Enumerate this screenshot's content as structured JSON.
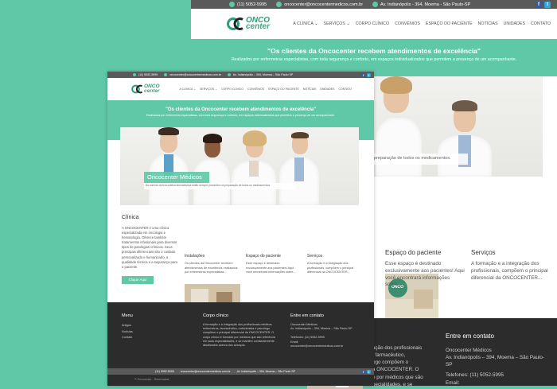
{
  "topbar": {
    "phone": "(11) 5052-5995",
    "email": "oncocenter@oncocentermedicos.com.br",
    "address": "Av. Indianópolis - 394, Moema - São Paulo-SP",
    "address_small": "Av. Indianópolis – 394, Moema – São Paulo SP",
    "social": [
      "f",
      "t"
    ]
  },
  "logo": {
    "line1": "ONCO",
    "line2": "center"
  },
  "nav": [
    "A CLÍNICA ⌄",
    "SERVIÇOS ⌄",
    "CORPO CLÍNICO",
    "CONVÊNIOS",
    "ESPAÇO DO PACIENTE",
    "NOTÍCIAS",
    "UNIDADES",
    "CONTATO"
  ],
  "hero": {
    "title": "\"Os clientes da Oncocenter recebem atendimentos de excelência\"",
    "subtitle": "Realizados por enfermeiras especialistas, com toda segurança e conforto, em espaços individualizados que permitem a presença de um acompanhante.",
    "subtitle_small": "Realizados por enfermeiras especialistas, com toda segurança e conforto, em espaços individualizados que permitem a presença de um acompanhante."
  },
  "slider": {
    "title": "Oncocenter Médicos",
    "caption": "As normas da boa prática farmacêutica estão sempre presentes na preparação de todos os medicamentos.",
    "caption_partial": "preparação de todos os medicamentos."
  },
  "clinica": {
    "title": "Clínica",
    "text": "A ONCOCENTER é uma clínica especializada em oncologia e hematologia. Oferece também tratamentos infusionais para diversos tipos de patologias crônicas. Seus principais diferenciais são o cuidado personalizado e humanizado, a qualidade técnica e a segurança para o paciente.",
    "button": "Clique Aqui"
  },
  "cards_small": [
    {
      "title": "Instalações",
      "text": "Os clientes da Oncocenter recebem atendimentos de excelência, realizados por enfermeiras especialistas..."
    },
    {
      "title": "Espaço do paciente",
      "text": "Esse espaço é destinado exclusivamente aos pacientes! Aqui você encontrará informações sobre..."
    },
    {
      "title": "Serviços",
      "text": "A formação e a integração dos profissionais, compõem o principal diferencial da ONCOCENTER..."
    }
  ],
  "cards_large": [
    {
      "title": "Espaço do paciente",
      "text": "Esse espaço é destinado exclusivamente aos pacientes! Aqui você encontrará informações sobre..."
    },
    {
      "title": "Serviços",
      "text": "A formação e a integração dos profissionais, compõem o principal diferencial da ONCOCENTER..."
    }
  ],
  "footer": {
    "menu_title": "Menu",
    "menu_items": [
      "Artigos",
      "Notícias",
      "Contato"
    ],
    "corpo_title": "Corpo clínico",
    "corpo_text": "A formação e a integração dos profissionais médicos, enfermeiros, farmacêutico, nutricionista e psicólogo compõem o principal diferencial da ONCOCENTER. O corpo clínico é formado por médicos que são referência em suas especialidades, e se mantêm constantemente atualizados acerca dos avanços.",
    "contato_title": "Entre em contato",
    "contato_name": "Oncocenter Médicos",
    "contato_address": "Av. Indianópolis – 394, Moema – São Paulo-SP",
    "contato_phone": "Telefones: (11) 5052-5995",
    "contato_email_label": "Email:",
    "contato_email": "oncocenter@oncocentermedicos.com.br",
    "copyright": "© Oncocenter - Reservados",
    "large_corpo_text_1": "ação dos profissionais",
    "large_corpo_text_2": ", farmacêutico,",
    "large_corpo_text_3": "ogo compõem o",
    "large_corpo_text_4": "a ONCOCENTER. O",
    "large_corpo_text_5": "o por médicos que são",
    "large_corpo_text_6": "pecialidades, e se",
    "large_contato_name": "Oncocenter Médicos",
    "large_contato_address": "Av. Indianópolis – 394, Moema – São Paulo-SP",
    "large_contato_phone": "Telefones: (11) 5052-5995",
    "large_contato_email_label": "Email:"
  },
  "colors": {
    "accent": "#5fc8a6",
    "dark": "#2c2c2c",
    "topbar": "#5a5a5a",
    "brand": "#2e9e75"
  }
}
